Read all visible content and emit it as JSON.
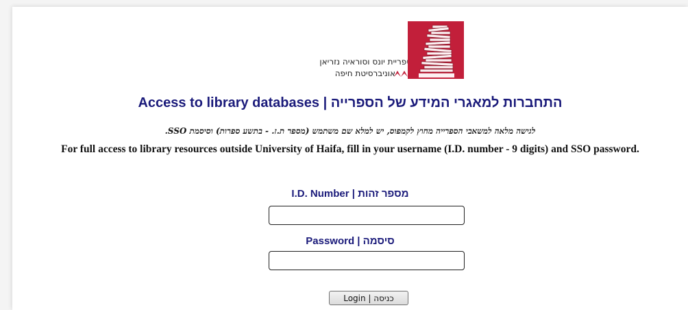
{
  "logo": {
    "library_name": "ספריית יונס וסוראיה נזריאן",
    "university_name": "אוניברסיטת חיפה",
    "brand_color": "#c21f3a"
  },
  "title": "Access to library databases | התחברות למאגרי המידע של הספרייה",
  "instructions": {
    "hebrew": "לגישה מלאה למשאבי הספרייה מחוץ לקמפוס, יש למלא שם משתמש (מספר ת.ז. - בתשע ספרות) וסיסמת SSO.",
    "english": "For full access to library resources outside University of Haifa, fill in your username (I.D. number - 9 digits) and SSO password."
  },
  "form": {
    "id_label": "I.D. Number | מספר זהות",
    "id_value": "",
    "password_label": "Password | סיסמה",
    "password_value": "",
    "login_label": "Login | כניסה"
  },
  "colors": {
    "heading": "#1a1a7a",
    "background": "#f4f4f4"
  }
}
